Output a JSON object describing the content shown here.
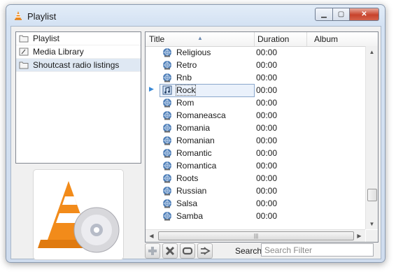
{
  "window": {
    "title": "Playlist"
  },
  "sidebar": {
    "items": [
      {
        "label": "Playlist",
        "icon": "folder-icon",
        "selected": false
      },
      {
        "label": "Media Library",
        "icon": "library-icon",
        "selected": false
      },
      {
        "label": "Shoutcast radio listings",
        "icon": "folder-icon",
        "selected": true
      }
    ]
  },
  "list": {
    "columns": [
      "Title",
      "Duration",
      "Album"
    ],
    "rows": [
      {
        "title": "Religious",
        "duration": "00:00"
      },
      {
        "title": "Retro",
        "duration": "00:00"
      },
      {
        "title": "Rnb",
        "duration": "00:00"
      },
      {
        "title": "Rock",
        "duration": "00:00",
        "selected": true,
        "playing": true
      },
      {
        "title": "Rom",
        "duration": "00:00"
      },
      {
        "title": "Romaneasca",
        "duration": "00:00"
      },
      {
        "title": "Romania",
        "duration": "00:00"
      },
      {
        "title": "Romanian",
        "duration": "00:00"
      },
      {
        "title": "Romantic",
        "duration": "00:00"
      },
      {
        "title": "Romantica",
        "duration": "00:00"
      },
      {
        "title": "Roots",
        "duration": "00:00"
      },
      {
        "title": "Russian",
        "duration": "00:00"
      },
      {
        "title": "Salsa",
        "duration": "00:00"
      },
      {
        "title": "Samba",
        "duration": "00:00"
      }
    ]
  },
  "toolbar": {
    "search_label": "Search",
    "search_placeholder": "Search Filter",
    "buttons": [
      "add-icon",
      "remove-icon",
      "loop-icon",
      "shuffle-icon"
    ]
  },
  "colors": {
    "accent": "#3a89d6",
    "selection": "#dfe8f3",
    "close": "#c8432c"
  }
}
